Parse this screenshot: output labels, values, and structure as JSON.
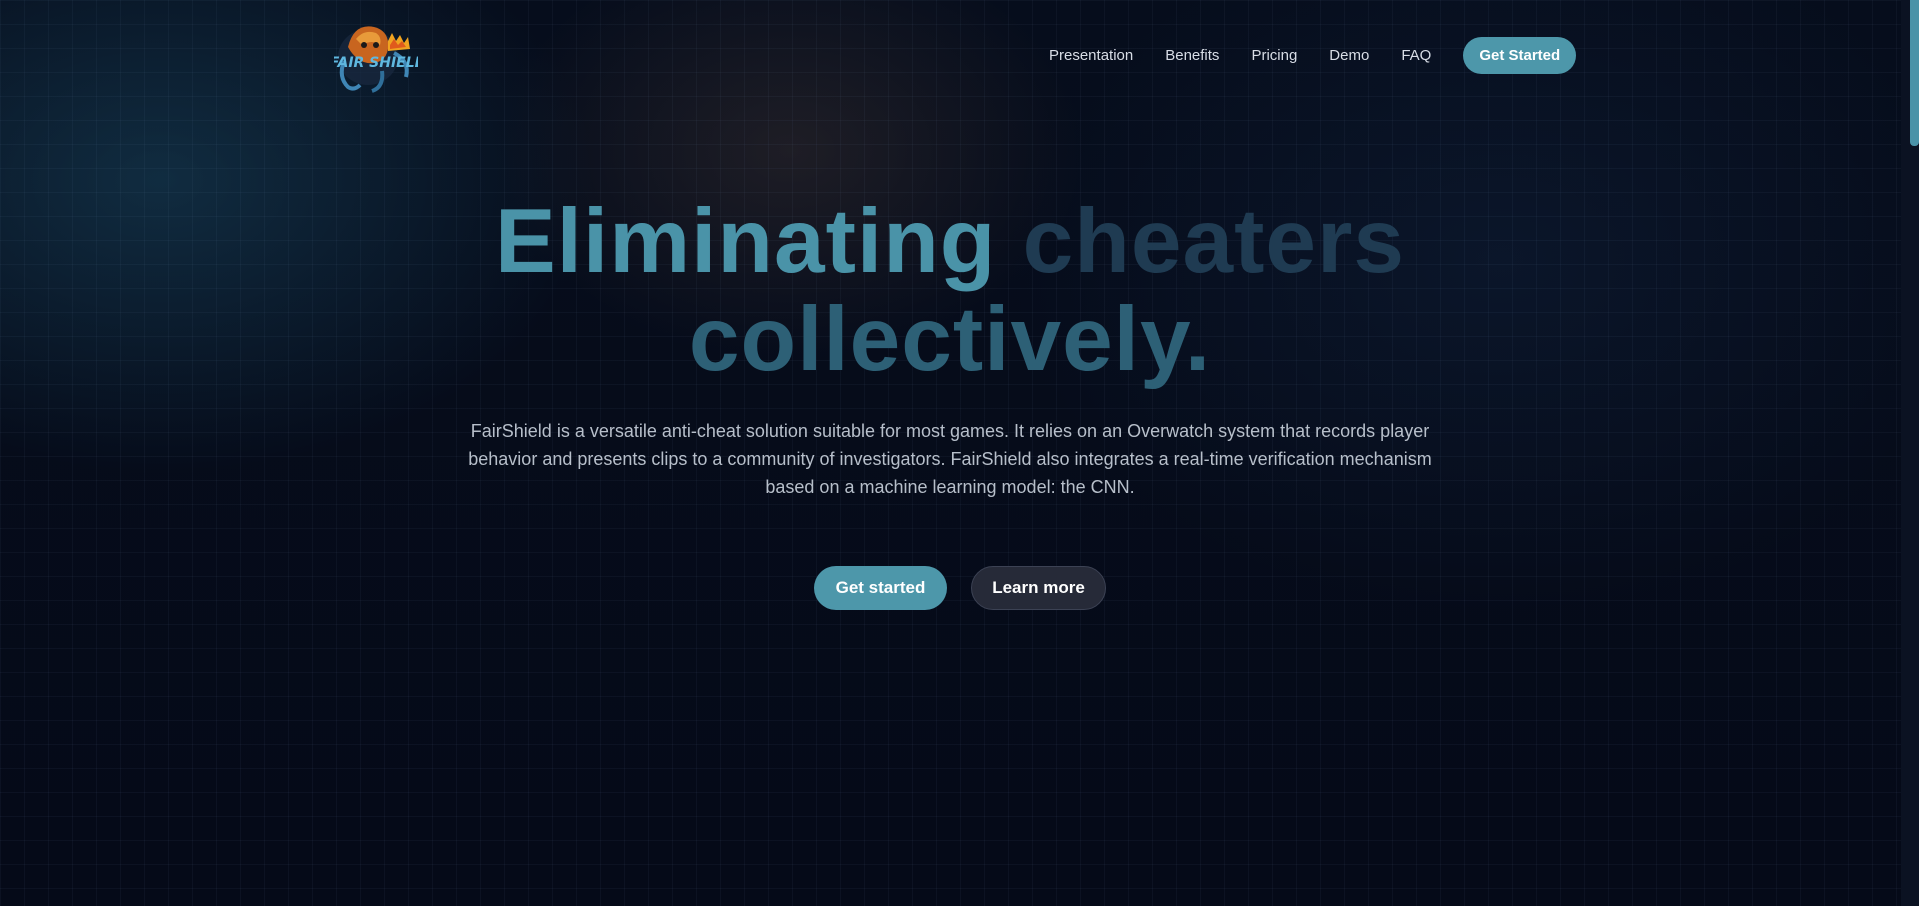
{
  "brand": {
    "logo_text": "FairShield",
    "logo_icon": "fairshield-octopus-logo"
  },
  "nav": {
    "items": [
      {
        "label": "Presentation"
      },
      {
        "label": "Benefits"
      },
      {
        "label": "Pricing"
      },
      {
        "label": "Demo"
      },
      {
        "label": "FAQ"
      }
    ],
    "cta_label": "Get Started"
  },
  "hero": {
    "title_part1": "Eliminating",
    "title_part2": "cheaters",
    "title_part3": "collectively.",
    "description": "FairShield is a versatile anti-cheat solution suitable for most games. It relies on an Overwatch system that records player behavior and presents clips to a community of investigators. FairShield also integrates a real-time verification mechanism based on a machine learning model: the CNN.",
    "primary_button": "Get started",
    "secondary_button": "Learn more"
  },
  "colors": {
    "accent": "#4d97aa",
    "background": "#050a18",
    "title_dim": "#1f3b52"
  }
}
